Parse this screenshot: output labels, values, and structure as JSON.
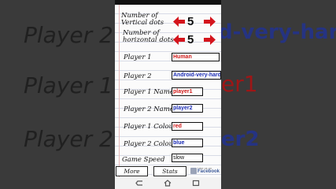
{
  "background": {
    "texts": [
      "Player 2",
      "Player 1",
      "Player 2",
      "d-very-hard",
      "er1",
      "er2"
    ]
  },
  "settings": {
    "vertical_dots": {
      "label_line1": "Number of",
      "label_line2": "Vertical dots",
      "value": "5"
    },
    "horizontal_dots": {
      "label_line1": "Number of",
      "label_line2": "horizontal dots",
      "value": "5"
    },
    "player1": {
      "label": "Player 1",
      "value": "Human",
      "color": "#d01818"
    },
    "player2": {
      "label": "Player 2",
      "value": "Android-very-hard",
      "color": "#1a2bb5"
    },
    "player1_name": {
      "label": "Player 1 Name",
      "value": "player1"
    },
    "player2_name": {
      "label": "Player 2 Name",
      "value": "player2"
    },
    "player1_colour": {
      "label": "Player 1 Colour",
      "value": "red"
    },
    "player2_colour": {
      "label": "Player 2 Colour",
      "value": "blue"
    },
    "game_speed": {
      "label": "Game Speed",
      "value": "slow"
    }
  },
  "buttons": {
    "more_apps": "More Apps",
    "stats": "Stats"
  },
  "facebook": {
    "like_text": "Like us on",
    "name": "Facebook"
  },
  "colors": {
    "arrow": "#d4141c",
    "red_text": "#d01818",
    "blue_text": "#1a2bb5"
  },
  "icons": [
    "left-arrow-icon",
    "right-arrow-icon",
    "thumbs-up-icon",
    "back-icon",
    "home-icon",
    "recent-apps-icon"
  ]
}
